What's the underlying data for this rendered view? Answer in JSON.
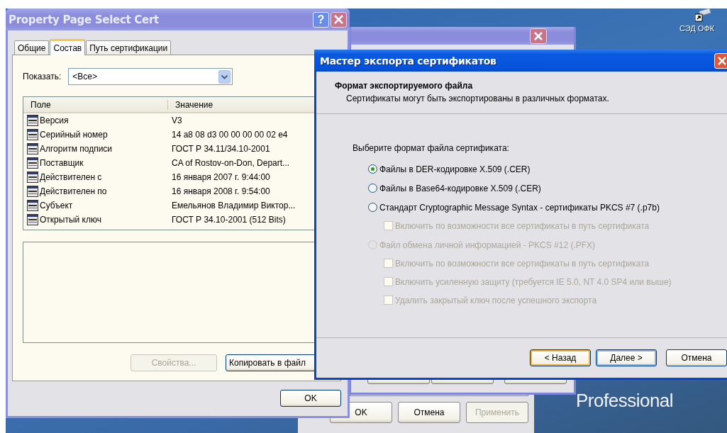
{
  "desktop": {
    "icon_label": "СЭД ОФК",
    "logo_text": "Professional"
  },
  "cert_window": {
    "title": "Property Page Select Cert",
    "help": "?",
    "tabs": [
      {
        "label": "Общие",
        "selected": false
      },
      {
        "label": "Состав",
        "selected": true
      },
      {
        "label": "Путь сертификации",
        "selected": false
      }
    ],
    "show_label": "Показать:",
    "show_value": "<Все>",
    "columns": [
      "Поле",
      "Значение"
    ],
    "rows": [
      {
        "field": "Версия",
        "value": "V3"
      },
      {
        "field": "Серийный номер",
        "value": "14 a8 08 d3 00 00 00 00 02 e4"
      },
      {
        "field": "Алгоритм подписи",
        "value": "ГОСТ Р 34.11/34.10-2001"
      },
      {
        "field": "Поставщик",
        "value": "CA of Rostov-on-Don, Depart..."
      },
      {
        "field": "Действителен с",
        "value": "16 января 2007 г. 9:44:00"
      },
      {
        "field": "Действителен по",
        "value": "16 января 2008 г. 9:54:00"
      },
      {
        "field": "Субъект",
        "value": "Емельянов Владимир Виктор..."
      },
      {
        "field": "Открытый ключ",
        "value": "ГОСТ Р 34.10-2001 (512 Bits)"
      }
    ],
    "panel_buttons": [
      {
        "label": "Свойства...",
        "disabled": true
      },
      {
        "label": "Копировать в файл",
        "disabled": false
      }
    ],
    "ok": "OK"
  },
  "back_window": {
    "buttons": [
      {
        "label": "OK",
        "disabled": false
      },
      {
        "label": "Отмена",
        "disabled": false
      },
      {
        "label": "Применить",
        "disabled": true
      }
    ]
  },
  "wizard": {
    "title": "Мастер экспорта сертификатов",
    "heading": "Формат экспортируемого файла",
    "subtitle": "Сертификаты могут быть экспортированы в различных форматах.",
    "prompt": "Выберите формат файла сертификата:",
    "formats": [
      {
        "label": "Файлы в DER-кодировке X.509 (.CER)",
        "selected": true,
        "disabled": false
      },
      {
        "label": "Файлы в Base64-кодировке X.509 (.CER)",
        "selected": false,
        "disabled": false
      },
      {
        "label": "Стандарт Cryptographic Message Syntax - сертификаты PKCS #7 (.p7b)",
        "selected": false,
        "disabled": false,
        "children": [
          {
            "label": "Включить по возможности все сертификаты в путь сертификата",
            "checked": false,
            "disabled": true
          }
        ]
      },
      {
        "label": "Файл обмена личной информацией - PKCS #12 (.PFX)",
        "selected": false,
        "disabled": true,
        "children": [
          {
            "label": "Включить по возможности все сертификаты в путь сертификата",
            "checked": false,
            "disabled": true
          },
          {
            "label": "Включить усиленную защиту (требуется IE 5.0, NT 4.0 SP4 или выше)",
            "checked": false,
            "disabled": true
          },
          {
            "label": "Удалить закрытый ключ после успешного экспорта",
            "checked": false,
            "disabled": true
          }
        ]
      }
    ],
    "buttons": [
      {
        "label": "< Назад",
        "focused": true,
        "default": false
      },
      {
        "label": "Далее >",
        "focused": false,
        "default": true
      },
      {
        "label": "Отмена",
        "focused": false,
        "default": false
      }
    ]
  }
}
